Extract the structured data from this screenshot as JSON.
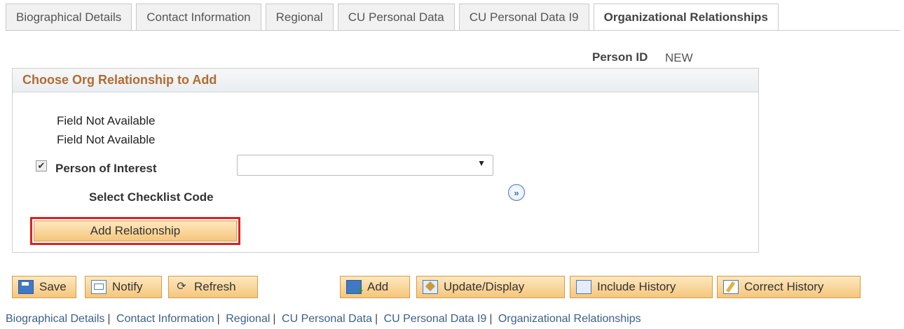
{
  "tabs": [
    {
      "label": "Biographical Details"
    },
    {
      "label": "Contact Information"
    },
    {
      "label": "Regional"
    },
    {
      "label": "CU Personal Data"
    },
    {
      "label": "CU Personal Data I9"
    },
    {
      "label": "Organizational Relationships",
      "active": true
    }
  ],
  "person": {
    "label": "Person ID",
    "value": "NEW"
  },
  "groupbox": {
    "title": "Choose Org Relationship to Add",
    "field_na_1": "Field Not Available",
    "field_na_2": "Field Not Available",
    "poi_label": "Person of Interest",
    "poi_checked": true,
    "poi_select_value": "",
    "checklist_label": "Select Checklist Code",
    "add_button": "Add Relationship"
  },
  "toolbar": {
    "save": "Save",
    "notify": "Notify",
    "refresh": "Refresh",
    "add": "Add",
    "update_display": "Update/Display",
    "include_history": "Include History",
    "correct_history": "Correct History"
  },
  "bottom_links": [
    "Biographical Details",
    "Contact Information",
    "Regional",
    "CU Personal Data",
    "CU Personal Data I9",
    "Organizational Relationships"
  ],
  "colors": {
    "header_text": "#b26b30",
    "button_fill": "#f5c67c",
    "highlight_border": "#e02020",
    "link": "#3b5f8c"
  }
}
